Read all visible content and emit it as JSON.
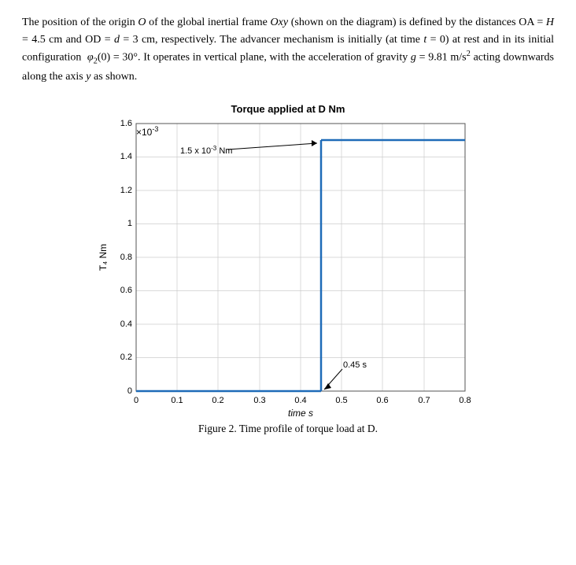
{
  "text": {
    "paragraph": "The position of the origin O of the global inertial frame Oxy (shown on the diagram) is defined by the distances OA = H = 4.5 cm and OD = d = 3 cm, respectively. The advancer mechanism is initially (at time t = 0) at rest and in its initial configuration φ₂(0) = 30°. It operates in vertical plane, with the acceleration of gravity g = 9.81 m/s² acting downwards along the axis y as shown."
  },
  "chart": {
    "title": "Torque applied at D  Nm",
    "y_axis_label": "T₄  Nm",
    "y_scale_note": "×10⁻³",
    "y_ticks": [
      "0",
      "0.2",
      "0.4",
      "0.6",
      "0.8",
      "1",
      "1.2",
      "1.4",
      "1.6"
    ],
    "x_ticks": [
      "0",
      "0.1",
      "0.2",
      "0.3",
      "0.4",
      "0.5",
      "0.6",
      "0.7",
      "0.8"
    ],
    "x_label": "time  s",
    "annotation_1": "1.5 x 10⁻³ Nm",
    "annotation_2": "0.45 s",
    "step_x": 0.45,
    "step_y": 1.5
  },
  "caption": "Figure 2. Time profile of torque load at D."
}
